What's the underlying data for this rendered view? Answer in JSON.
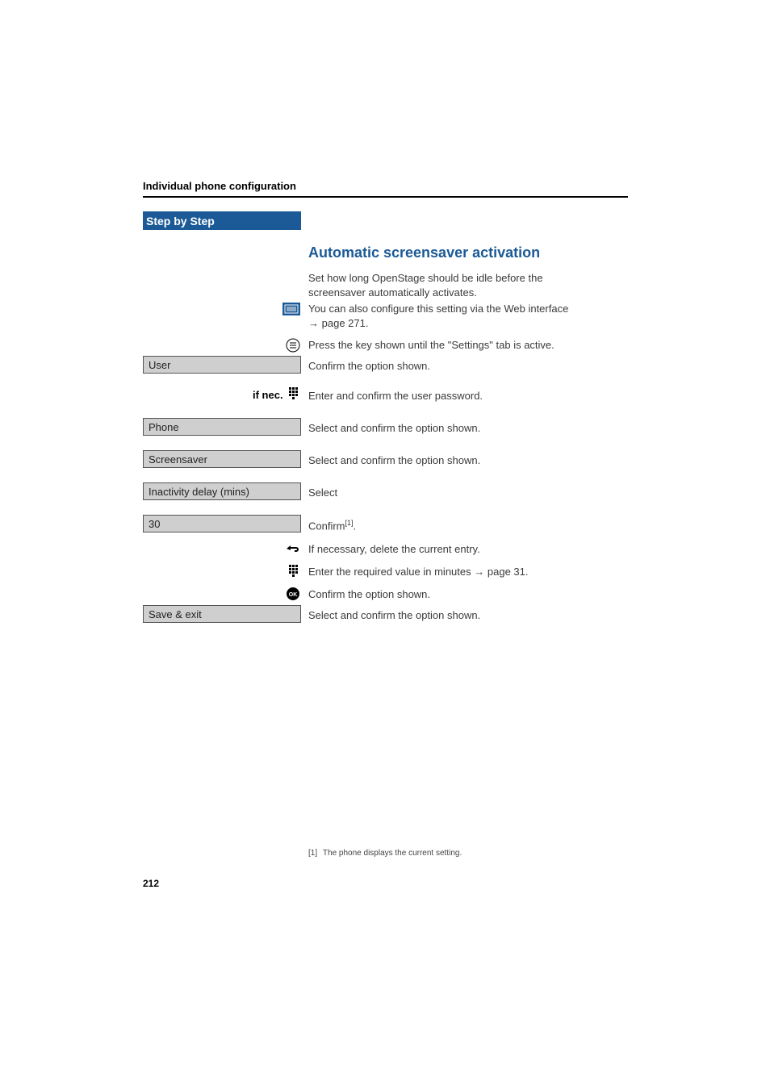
{
  "header": {
    "section_title": "Individual phone configuration"
  },
  "step_bar": {
    "label": "Step by Step"
  },
  "heading": "Automatic screensaver activation",
  "intro": {
    "l1": "Set how long OpenStage should be idle before the",
    "l2": "screensaver automatically activates."
  },
  "web": {
    "text_a": "You can also configure this setting via the Web interface",
    "text_b": "page 271."
  },
  "steps": {
    "press_key": "Press the key shown until the \"Settings\" tab is active.",
    "user_box": "User",
    "user_instr": "Confirm the option shown.",
    "if_nec": "if nec.",
    "password": "Enter and confirm the user password.",
    "phone_box": "Phone",
    "phone_instr": "Select and confirm the option shown.",
    "screensaver_box": "Screensaver",
    "screensaver_instr": "Select and confirm the option shown.",
    "inactivity_box": "Inactivity delay (mins)",
    "inactivity_instr": "Select",
    "value_box": "30",
    "value_instr_a": "Confirm",
    "value_instr_b": ".",
    "value_fn_ref": "[1]",
    "delete_instr": "If necessary, delete the current entry.",
    "value_entry_a": "Enter the required value in minutes",
    "value_entry_b": "page 31.",
    "confirm_ok": "Confirm the option shown.",
    "save_box": "Save & exit",
    "save_instr": "Select and confirm the option shown."
  },
  "footnote": {
    "marker": "[1]",
    "text": "The phone displays the current setting."
  },
  "page_number": "212"
}
